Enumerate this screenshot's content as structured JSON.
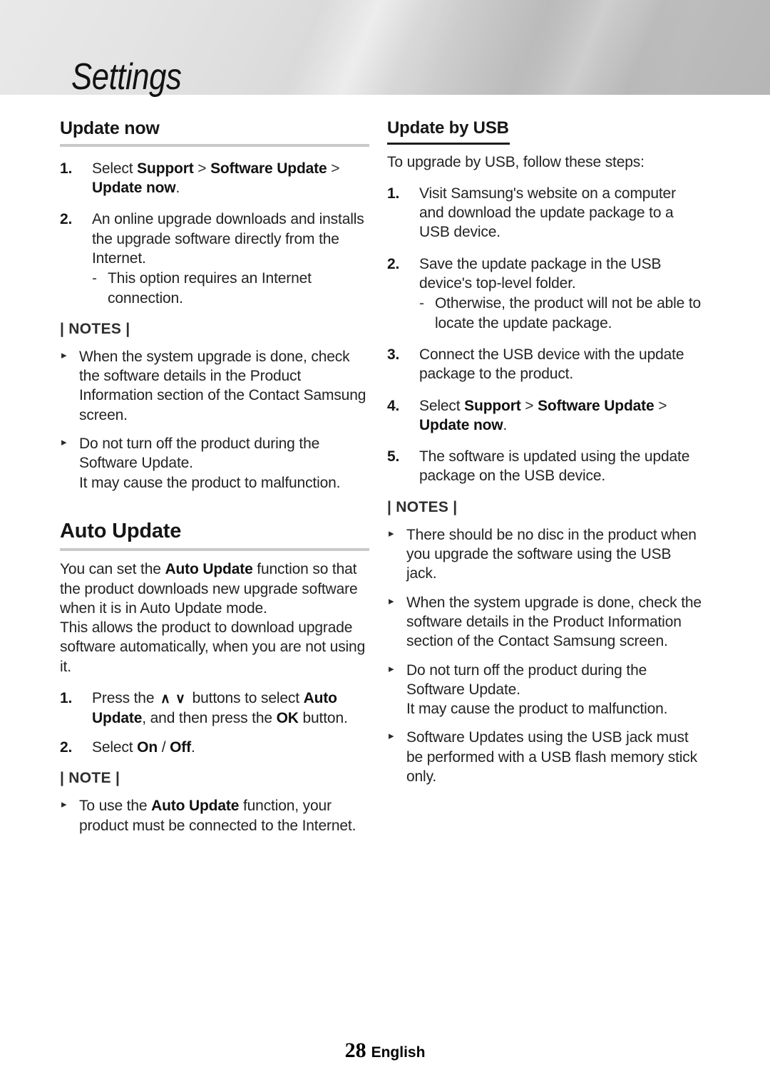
{
  "banner": {
    "title": "Settings"
  },
  "left_column": {
    "heading_update_now": "Update now",
    "steps": [
      {
        "num": "1.",
        "pre": "Select ",
        "b1": "Support",
        "gt1": " > ",
        "b2": "Software Update",
        "gt2": " > ",
        "b3": "Update now",
        "post": "."
      },
      {
        "num": "2.",
        "text": "An online upgrade downloads and installs the upgrade software directly from the Internet.",
        "sub_dash": "-",
        "sub_text": "This option requires an Internet connection."
      }
    ],
    "notes_label": "| NOTES |",
    "notes": [
      {
        "bullet": "▸",
        "text": "When the system upgrade is done, check the software details in the Product Information section of the Contact Samsung screen."
      },
      {
        "bullet": "▸",
        "text": "Do not turn off the product during the Software Update.",
        "line2": "It may cause the product to malfunction."
      }
    ],
    "heading_auto_update": "Auto Update",
    "auto_update_para1_pre": "You can set the ",
    "auto_update_para1_bold": "Auto Update",
    "auto_update_para1_post": " function so that the product downloads new upgrade software when it is in Auto Update mode.",
    "auto_update_para2": "This allows the product to download upgrade software automatically, when you are not using it.",
    "auto_steps": [
      {
        "num": "1.",
        "pre": "Press the ",
        "chev_up": "∧",
        "chev_down": "∨",
        "mid": " buttons to select ",
        "b1": "Auto Update",
        "mid2": ", and then press the ",
        "b2": "OK",
        "post": " button."
      },
      {
        "num": "2.",
        "pre": "Select ",
        "b1": "On",
        "mid": " / ",
        "b2": "Off",
        "post": "."
      }
    ],
    "note_label": "| NOTE |",
    "note_items": [
      {
        "bullet": "▸",
        "pre": "To use the ",
        "b1": "Auto Update",
        "post": " function, your product must be connected to the Internet."
      }
    ]
  },
  "right_column": {
    "heading_update_by_usb": "Update by USB",
    "intro": "To upgrade by USB, follow these steps:",
    "steps": [
      {
        "num": "1.",
        "text": "Visit Samsung's website on a computer and download the update package to a USB device."
      },
      {
        "num": "2.",
        "text": "Save the update package in the USB device's top-level folder.",
        "sub_dash": "-",
        "sub_text": "Otherwise, the product will not be able to locate the update package."
      },
      {
        "num": "3.",
        "text": "Connect the USB device with the update package to the product."
      },
      {
        "num": "4.",
        "pre": "Select ",
        "b1": "Support",
        "gt1": " > ",
        "b2": "Software Update",
        "gt2": " > ",
        "b3": "Update now",
        "post": "."
      },
      {
        "num": "5.",
        "text": "The software is updated using the update package on the USB device."
      }
    ],
    "notes_label": "| NOTES |",
    "notes": [
      {
        "bullet": "▸",
        "text": "There should be no disc in the product when you upgrade the software using the USB jack."
      },
      {
        "bullet": "▸",
        "text": "When the system upgrade is done, check the software details in the Product Information section of the Contact Samsung screen."
      },
      {
        "bullet": "▸",
        "text": "Do not turn off the product during the Software Update.",
        "line2": "It may cause the product to malfunction."
      },
      {
        "bullet": "▸",
        "text": "Software Updates using the USB jack must be performed with a USB flash memory stick only."
      }
    ]
  },
  "footer": {
    "page_number": "28",
    "language": "English"
  },
  "colors": {
    "rule_gray": "#c9c9c9",
    "rule_dark": "#1d1d1d",
    "text": "#232323",
    "heading": "#161616"
  }
}
